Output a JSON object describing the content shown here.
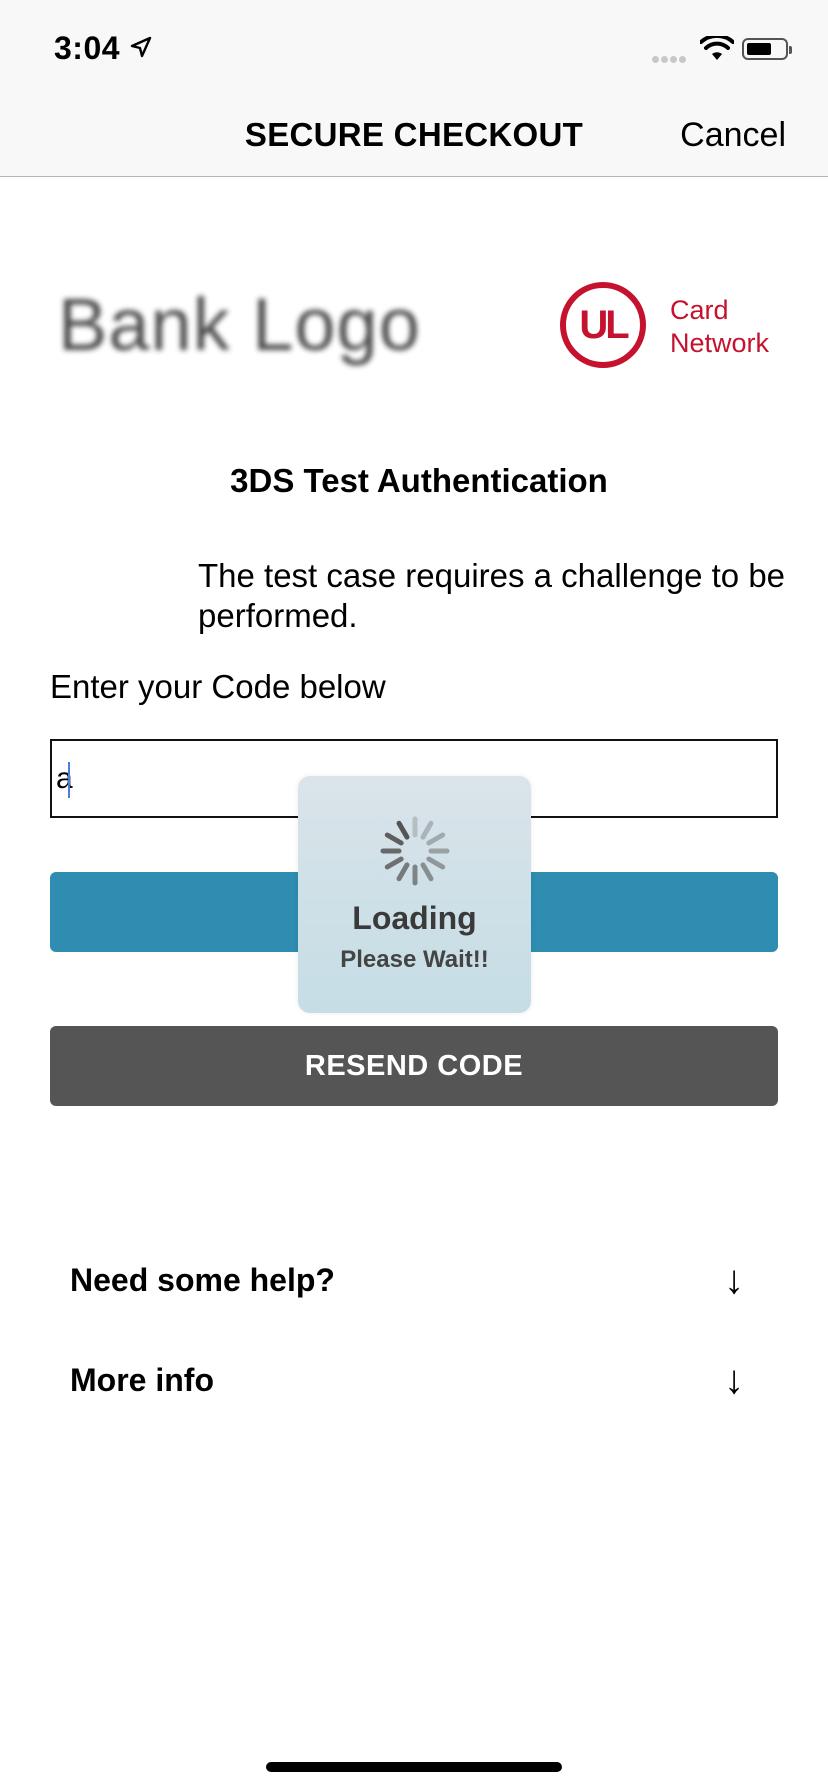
{
  "status_bar": {
    "time": "3:04"
  },
  "nav": {
    "title": "SECURE CHECKOUT",
    "cancel_label": "Cancel"
  },
  "logos": {
    "bank": "Bank Logo",
    "network_mark": "UL",
    "network_line1": "Card",
    "network_line2": "Network"
  },
  "challenge": {
    "title": "3DS Test Authentication",
    "description": "The test case requires a challenge to be performed.",
    "code_label": "Enter your Code below",
    "code_value": "a"
  },
  "buttons": {
    "resend_label": "RESEND CODE"
  },
  "help": {
    "need_help_label": "Need some help?",
    "more_info_label": "More info",
    "arrow": "↓"
  },
  "loading": {
    "title": "Loading",
    "subtitle": "Please Wait!!"
  },
  "colors": {
    "submit": "#2e8db0",
    "resend": "#555555",
    "network_red": "#c4122f"
  }
}
